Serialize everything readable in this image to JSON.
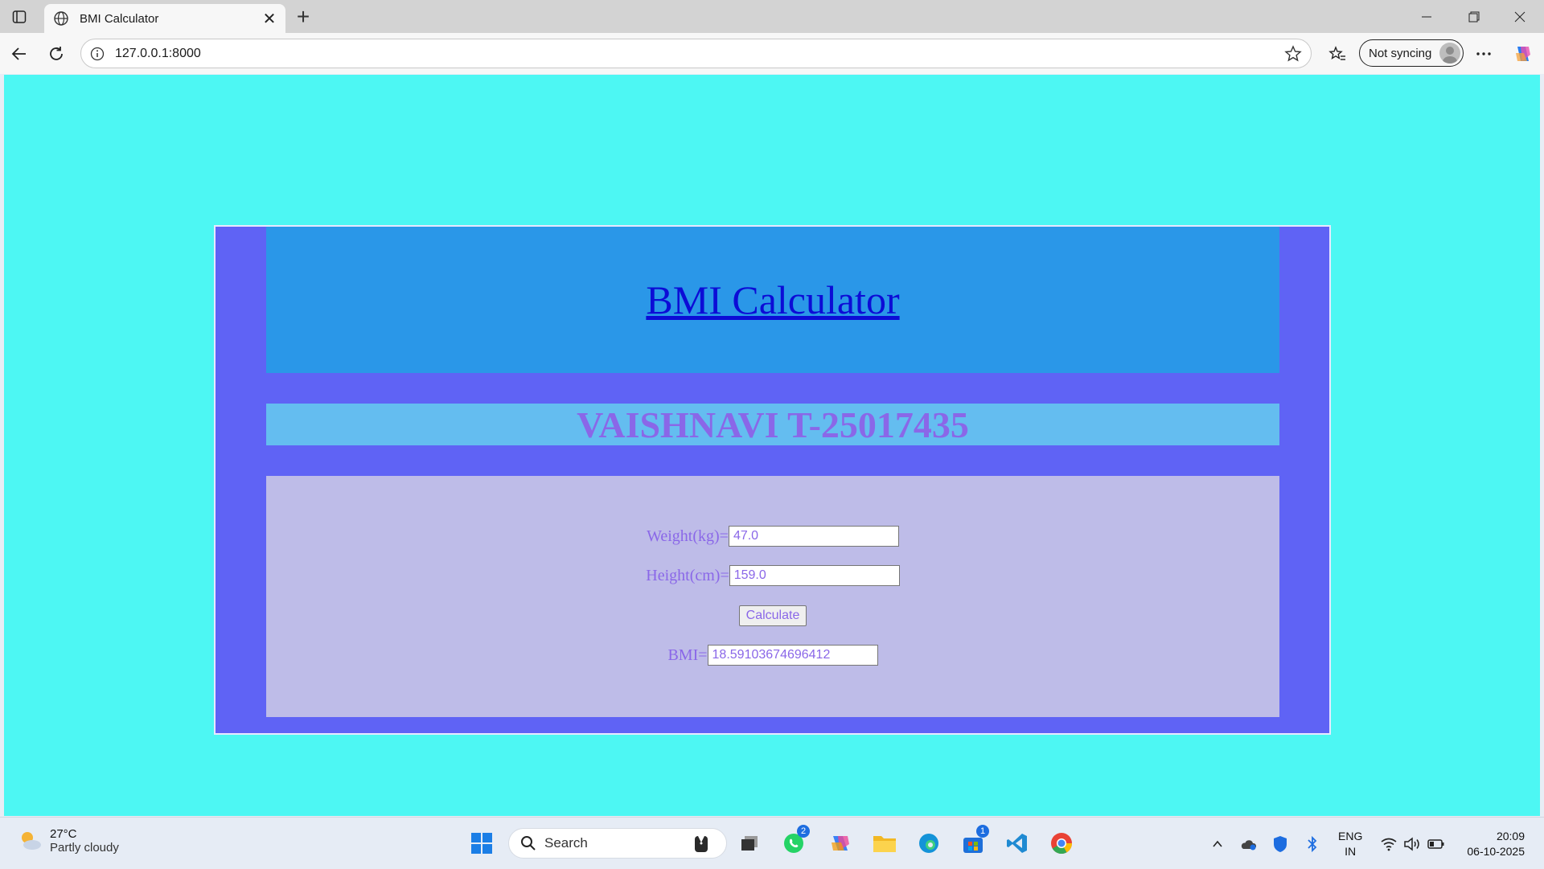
{
  "browser": {
    "tab_title": "BMI Calculator",
    "url": "127.0.0.1:8000",
    "sync_label": "Not syncing"
  },
  "page": {
    "heading": "BMI Calculator",
    "name_banner": "VAISHNAVI T-25017435",
    "weight_label": "Weight(kg)=",
    "weight_value": "47.0",
    "height_label": "Height(cm)=",
    "height_value": "159.0",
    "calculate_label": "Calculate",
    "bmi_label": "BMI=",
    "bmi_value": "18.59103674696412"
  },
  "taskbar": {
    "weather_temp": "27°C",
    "weather_condition": "Partly cloudy",
    "search_placeholder": "Search",
    "whatsapp_badge": "2",
    "store_badge": "1",
    "lang_line1": "ENG",
    "lang_line2": "IN",
    "time": "20:09",
    "date": "06-10-2025"
  },
  "colors": {
    "page_bg": "#4df7f3",
    "outer_box": "#5f63f5",
    "header_box": "#2a97e8",
    "name_box": "#64bdf0",
    "form_box": "#bebce8",
    "accent_text": "#8a67e8"
  }
}
